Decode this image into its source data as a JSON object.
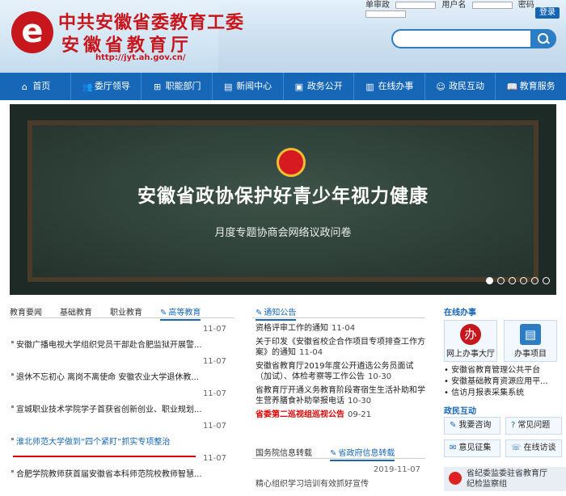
{
  "header": {
    "logo_char": "e",
    "title1": "中共安徽省委教育工委",
    "title2": "安徽省教育厅",
    "url": "http://jyt.ah.gov.cn/",
    "login": {
      "type_label": "单审政",
      "user_label": "用户名",
      "pwd_label": "密码",
      "login_btn": "登录"
    },
    "search_placeholder": ""
  },
  "nav": {
    "items": [
      {
        "label": "首页",
        "icon": "⌂"
      },
      {
        "label": "委厅领导",
        "icon": "👥"
      },
      {
        "label": "职能部门",
        "icon": "⊞"
      },
      {
        "label": "新闻中心",
        "icon": "▤"
      },
      {
        "label": "政务公开",
        "icon": "▣"
      },
      {
        "label": "在线办事",
        "icon": "▥"
      },
      {
        "label": "政民互动",
        "icon": "☺"
      },
      {
        "label": "教育服务",
        "icon": "📖"
      }
    ]
  },
  "banner": {
    "title": "安徽省政协保护好青少年视力健康",
    "subtitle": "月度专题协商会网络议政问卷"
  },
  "news": {
    "tabs": [
      "教育要闻",
      "基础教育",
      "职业教育",
      "高等教育"
    ],
    "items": [
      {
        "date": "11-07",
        "text": "安徽广播电视大学组织党员干部赴合肥监狱开展警..."
      },
      {
        "date": "11-07",
        "text": "退休不忘初心 离岗不离使命 安徽农业大学退休教..."
      },
      {
        "date": "11-07",
        "text": "宣城职业技术学院学子首获省创新创业、职业规划..."
      },
      {
        "date": "11-07",
        "text": "淮北师范大学做到“四个紧盯”抓实专项整治"
      },
      {
        "date": "11-07",
        "text": "合肥学院教师获首届安徽省本科师范院校教师智慧..."
      }
    ]
  },
  "notice": {
    "tab": "通知公告",
    "items": [
      {
        "text": "资格评审工作的通知",
        "date": "11-04",
        "red": false
      },
      {
        "text": "关于印发《安徽省校企合作项目专项排查工作方案》的通知",
        "date": "11-04",
        "red": false
      },
      {
        "text": "安徽省教育厅2019年度公开遴选公务员面试（加试）、体检考察等工作公告",
        "date": "10-30",
        "red": false
      },
      {
        "text": "省教育厅开通义务教育阶段寄宿生生活补助和学生营养膳食补助举报电话",
        "date": "10-30",
        "red": false
      },
      {
        "text": "省委第二巡视组巡视公告",
        "date": "09-21",
        "red": true
      }
    ],
    "gov_tabs": [
      "国务院信息转载",
      "省政府信息转载"
    ],
    "gov_date": "2019-11-07",
    "gov_first": "精心组织学习培训有效抓好宣传"
  },
  "online": {
    "title": "在线办事",
    "services": [
      {
        "label": "网上办事大厅",
        "icon": "办"
      },
      {
        "label": "办事项目",
        "icon": "▤"
      }
    ],
    "links": [
      "安徽省教育管理公共平台",
      "安徽基础教育资源应用平...",
      "信访月报表采集系统"
    ],
    "interaction_title": "政民互动",
    "buttons": [
      {
        "label": "我要咨询",
        "icon": "✎"
      },
      {
        "label": "常见问题",
        "icon": "?"
      },
      {
        "label": "意见征集",
        "icon": "✉"
      },
      {
        "label": "在线访谈",
        "icon": "☏"
      }
    ],
    "jiwei_line1": "省纪委监委驻省教育厅",
    "jiwei_line2": "纪检监察组"
  }
}
